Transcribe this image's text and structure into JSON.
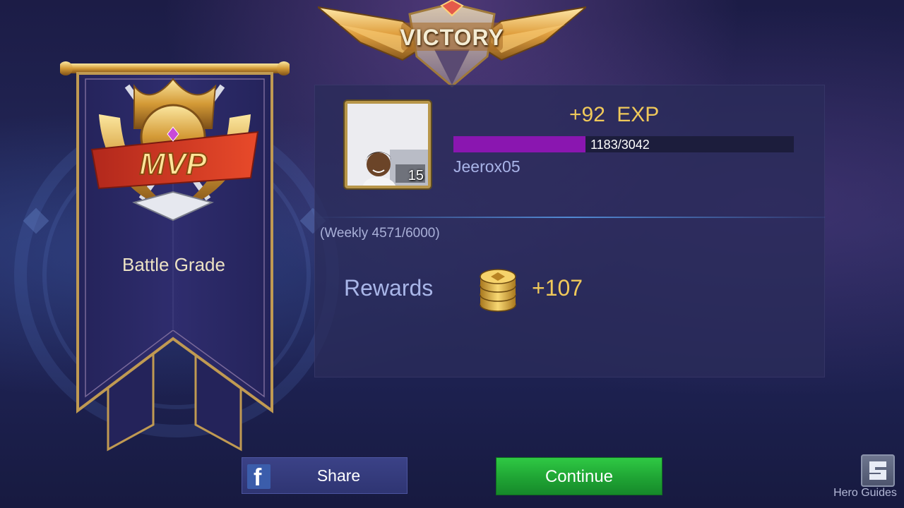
{
  "header": {
    "title": "VICTORY"
  },
  "battle": {
    "grade_badge": "MVP",
    "grade_label": "Battle Grade"
  },
  "player": {
    "name": "Jeerox05",
    "level": "15",
    "exp_gain": "+92  EXP",
    "exp_progress_text": "1183/3042",
    "exp_current": 1183,
    "exp_max": 3042,
    "weekly": "(Weekly 4571/6000)"
  },
  "rewards": {
    "label": "Rewards",
    "amount": "+107",
    "icon": "gold-coins-icon"
  },
  "buttons": {
    "share": "Share",
    "continue": "Continue"
  },
  "hero_guides": {
    "label": "Hero Guides",
    "icon": "hero-guides-icon"
  },
  "colors": {
    "exp_fill": "#8a16b0",
    "gold_text": "#f0c95a",
    "continue_green": "#1fa434",
    "share_blue": "#2f3573"
  }
}
